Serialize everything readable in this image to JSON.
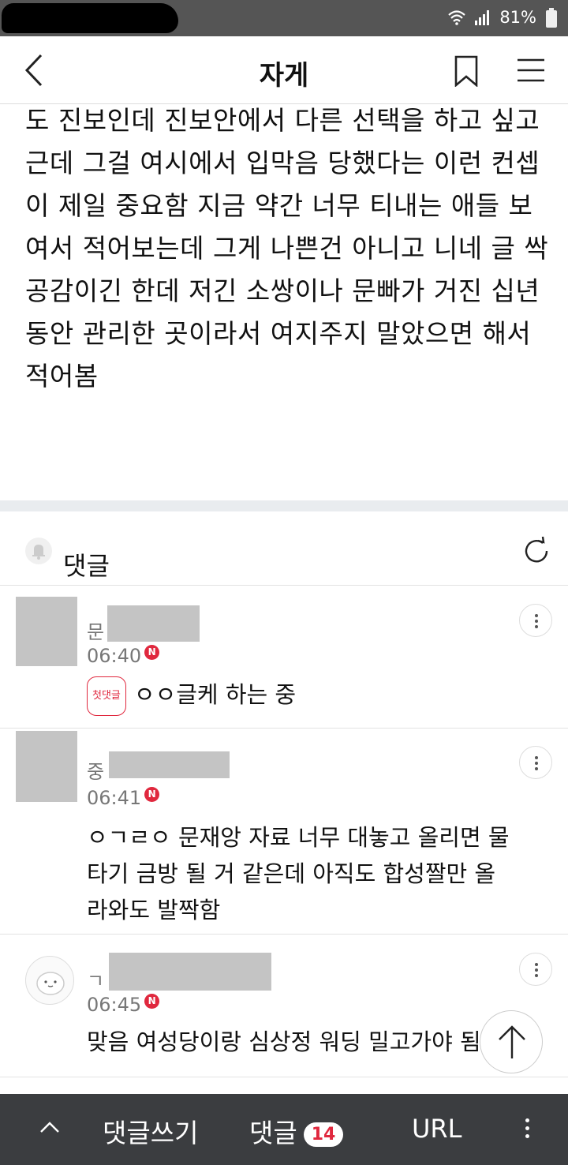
{
  "status_bar": {
    "battery": "81%"
  },
  "nav": {
    "title": "자게"
  },
  "post": {
    "lines": [
      "도 진보인데 진보안에서 다른 선택을 하고 싶고",
      "근데 그걸 여시에서 입막음 당했다는 이런 컨셉",
      "이 제일 중요함 지금 약간 너무 티내는 애들 보",
      "여서 적어보는데 그게 나쁜건 아니고 니네 글 싹",
      "공감이긴 한데 저긴 소쌍이나 문빠가 거진 십년",
      "동안 관리한 곳이라서 여지주지 말았으면 해서",
      "적어봄"
    ]
  },
  "comments_header": {
    "label": "댓글"
  },
  "comments": [
    {
      "author_initial": "문",
      "time": "06:40",
      "badge": "N",
      "first_badge": "첫댓글",
      "lines": [
        "ㅇㅇ글케 하는 중"
      ]
    },
    {
      "author_initial": "중",
      "time": "06:41",
      "badge": "N",
      "lines": [
        "ㅇㄱㄹㅇ 문재앙 자료 너무 대놓고 올리면 물",
        "타기 금방 될 거 같은데 아직도 합성짤만 올",
        "라와도 발짝함"
      ]
    },
    {
      "author_initial": "ㄱ",
      "time": "06:45",
      "badge": "N",
      "lines": [
        "맞음 여성당이랑 심상정 워딩 밀고가야 됨"
      ]
    }
  ],
  "bottom_bar": {
    "write_label": "댓글쓰기",
    "comments_label": "댓글",
    "comment_count": "14",
    "url_label": "URL"
  }
}
